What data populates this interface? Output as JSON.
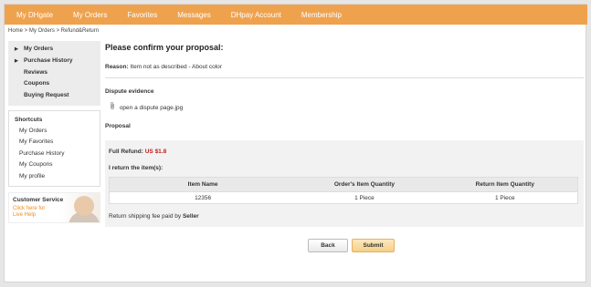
{
  "topnav": {
    "items": [
      "My DHgate",
      "My Orders",
      "Favorites",
      "Messages",
      "DHpay Account",
      "Membership"
    ]
  },
  "breadcrumb": "Home > My Orders > Refund&Return",
  "sidebar": {
    "items": [
      {
        "label": "My Orders"
      },
      {
        "label": "Purchase History"
      },
      {
        "label": "Reviews"
      },
      {
        "label": "Coupons"
      },
      {
        "label": "Buying Request"
      }
    ],
    "arrow_glyph": "▶",
    "shortcuts_title": "Shortcuts",
    "shortcuts": [
      "My Orders",
      "My Favorites",
      "Purchase History",
      "My Coupons",
      "My profile"
    ],
    "customer_service": {
      "title": "Customer Service",
      "link": "Click here for Live Help"
    }
  },
  "main": {
    "title": "Please confirm your proposal:",
    "reason_label": "Reason:",
    "reason_text": "Item not as described - About color",
    "dispute_title": "Dispute evidence",
    "attachment": "open a dispute page.jpg",
    "proposal_title": "Proposal",
    "full_refund_label": "Full Refund:",
    "full_refund_amount": "US $1.8",
    "return_title": "I return the item(s):",
    "table": {
      "headers": [
        "Item Name",
        "Order's Item Quantity",
        "Return Item Quantity"
      ],
      "rows": [
        [
          "12356",
          "1 Piece",
          "1 Piece"
        ]
      ]
    },
    "shipping_label": "Return shipping fee paid by",
    "shipping_payer": "Seller",
    "back_label": "Back",
    "submit_label": "Submit"
  },
  "colors": {
    "nav_bg": "#efa24d",
    "refund_amount": "#c02020",
    "live_help": "#f08a1c"
  },
  "icons": {
    "sidebar_arrow": "triangle-right-icon",
    "attachment": "paperclip-icon"
  }
}
